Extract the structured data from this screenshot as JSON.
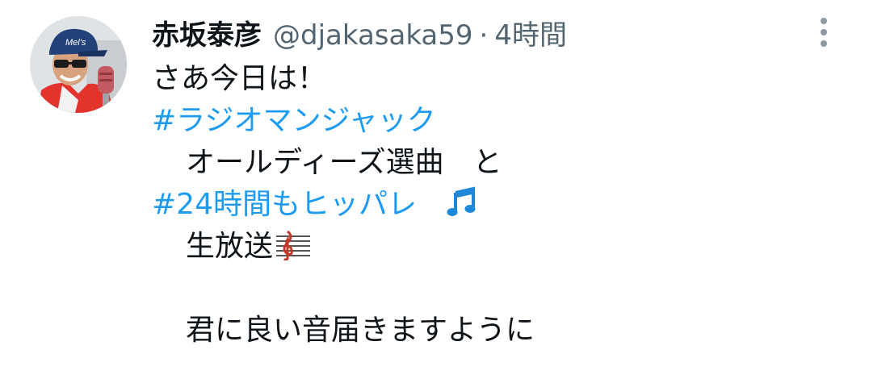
{
  "tweet": {
    "author": {
      "display_name": "赤坂泰彦",
      "handle": "@djakasaka59",
      "separator": "·",
      "time": "4時間"
    },
    "lines": [
      "さあ今日は！",
      "#ラジオマンジャック",
      "オールディーズ選曲　と",
      "#24時間もヒッパレ",
      "生放送",
      "",
      "君に良い音届きますように"
    ],
    "icons": {
      "avatar": "profile-photo",
      "more": "more-vertical-icon",
      "music_emoji": "musical-notes-emoji",
      "score_emoji": "musical-score-emoji"
    },
    "colors": {
      "hashtag": "#1d9bf0",
      "secondary_text": "#536471",
      "primary_text": "#0f1419"
    }
  }
}
